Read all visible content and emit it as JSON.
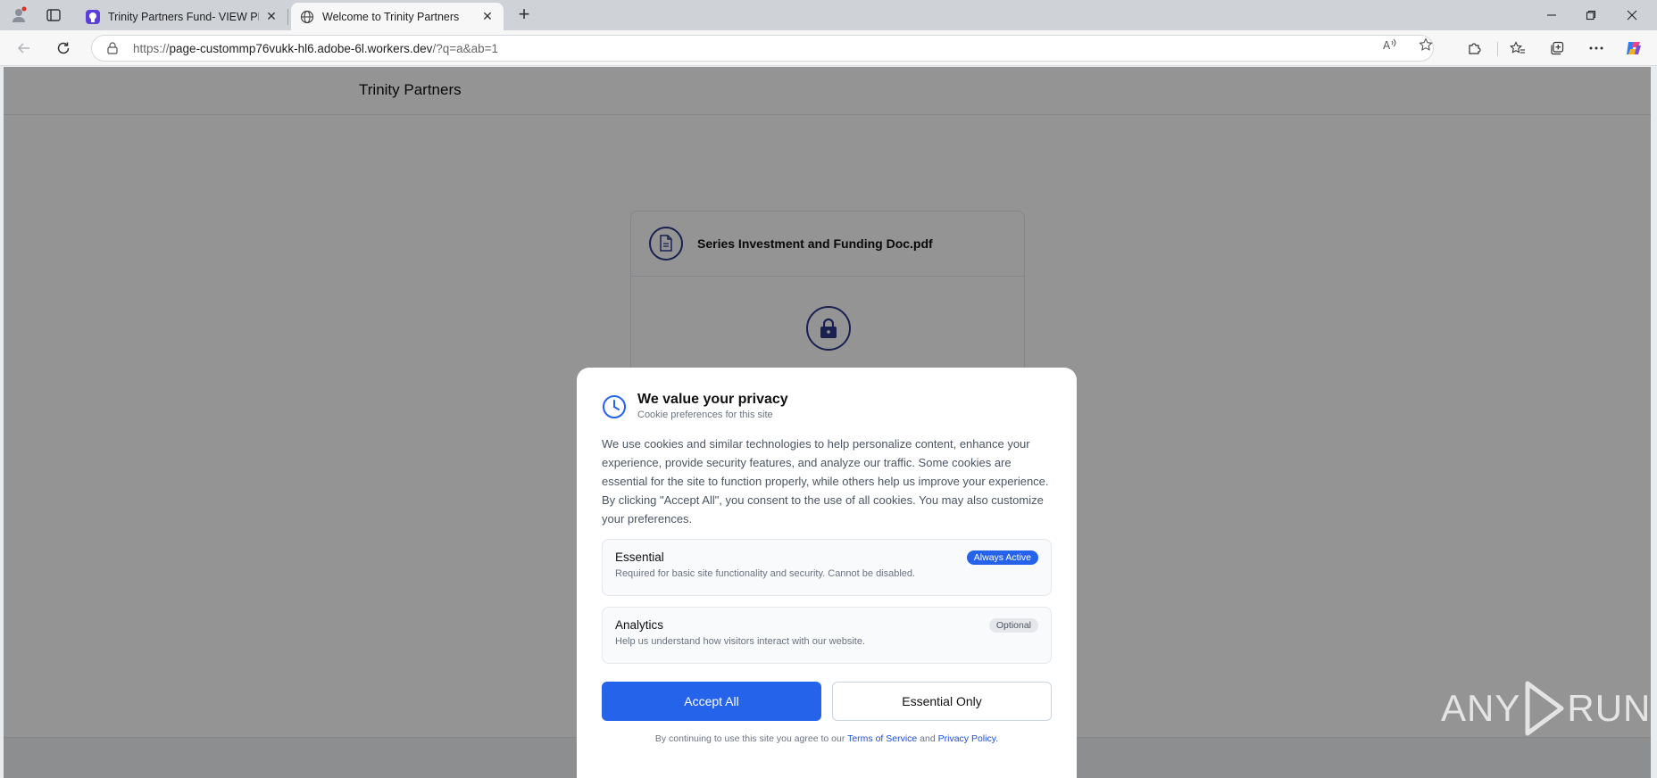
{
  "browser": {
    "tabs": [
      {
        "title": "Trinity Partners Fund- VIEW PRESE",
        "active": false
      },
      {
        "title": "Welcome to Trinity Partners",
        "active": true
      }
    ],
    "url_scheme": "https://",
    "url_host": "page-custommp76vukk-hl6.adobe-6l.workers.dev",
    "url_path": "/?q=a&ab=1",
    "icons": {
      "profile": "profile-icon",
      "workspaces": "tab-actions-icon",
      "back": "back-arrow-icon",
      "refresh": "refresh-icon",
      "read_aloud": "read-aloud-icon",
      "favorite": "star-icon",
      "extensions": "puzzle-icon",
      "favorites": "favorites-icon",
      "collections": "collections-icon",
      "more": "more-dots-icon",
      "copilot": "copilot-icon"
    }
  },
  "site": {
    "brand": "Trinity Partners",
    "document_name": "Series Investment and Funding Doc.pdf"
  },
  "consent": {
    "title": "We value your privacy",
    "subtitle": "Cookie preferences for this site",
    "body": "We use cookies and similar technologies to help personalize content, enhance your experience, provide security features, and analyze our traffic. Some cookies are essential for the site to function properly, while others help us improve your experience. By clicking \"Accept All\", you consent to the use of all cookies. You may also customize your preferences.",
    "categories": [
      {
        "name": "Essential",
        "description": "Required for basic site functionality and security. Cannot be disabled.",
        "badge": "Always Active"
      },
      {
        "name": "Analytics",
        "description": "Help us understand how visitors interact with our website.",
        "badge": "Optional"
      }
    ],
    "accept_label": "Accept All",
    "essential_label": "Essential Only",
    "footer_prefix": "By continuing to use this site you agree to our",
    "terms_label": "Terms of Service",
    "and_text": "and",
    "privacy_label": "Privacy Policy."
  },
  "watermark": {
    "left": "ANY",
    "right": "RUN"
  },
  "colors": {
    "accent": "#2563eb",
    "icon_navy": "#2d3a8c"
  }
}
